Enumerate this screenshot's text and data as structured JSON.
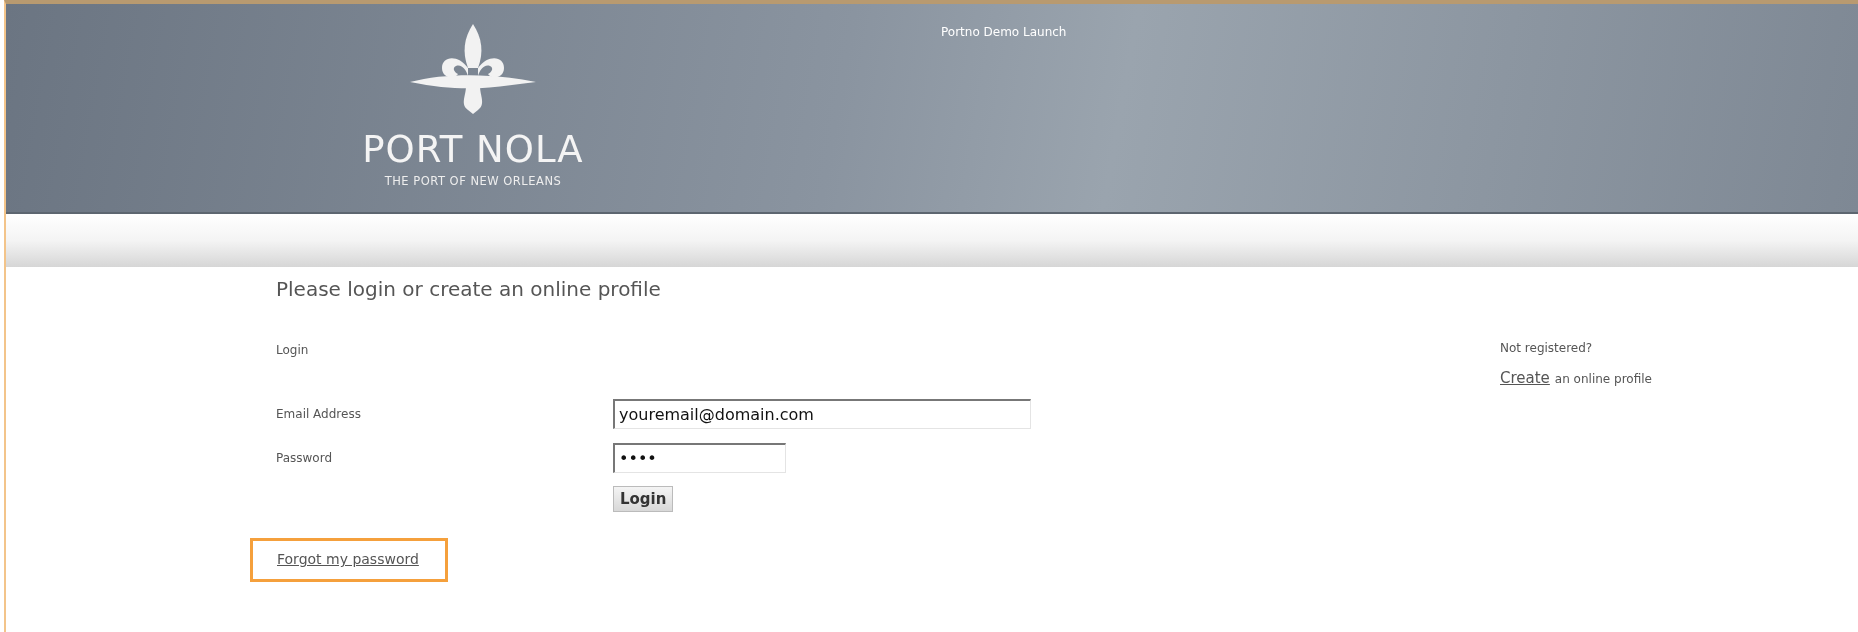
{
  "header": {
    "logo": {
      "name": "PORT NOLA",
      "tagline": "THE PORT OF NEW ORLEANS"
    },
    "title": "Portno Demo Launch"
  },
  "heading": "Please login or create an online profile",
  "login": {
    "label": "Login",
    "fields": [
      {
        "label": "Email Address",
        "value": "youremail@domain.com",
        "kind": "wide"
      },
      {
        "label": "Password",
        "value": "••••",
        "kind": "narrow"
      }
    ],
    "button": "Login",
    "forgot_link": {
      "text": "Forgot my password",
      "highlighted": true
    }
  },
  "register": {
    "question": "Not registered?",
    "link": "Create",
    "suffix": "an online profile"
  }
}
